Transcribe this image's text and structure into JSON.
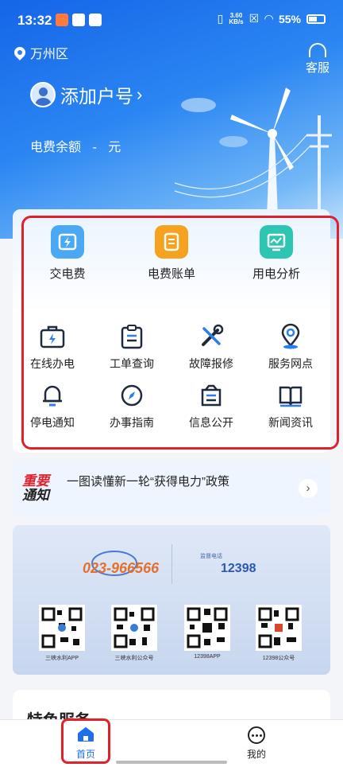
{
  "status_bar": {
    "time": "13:32",
    "net_speed_value": "3.60",
    "net_speed_unit": "KB/s",
    "battery": "55%"
  },
  "header": {
    "location": "万州区",
    "service_label": "客服"
  },
  "account": {
    "add_label": "添加户号",
    "chevron": "›",
    "balance_label": "电费余额",
    "balance_value": "-",
    "balance_unit": "元"
  },
  "quick_services": [
    {
      "label": "交电费",
      "icon": "wallet-bolt-icon",
      "color": "#4aa8f5"
    },
    {
      "label": "电费账单",
      "icon": "bill-icon",
      "color": "#f6a21e"
    },
    {
      "label": "用电分析",
      "icon": "monitor-chart-icon",
      "color": "#2cc6b2"
    }
  ],
  "services": [
    {
      "label": "在线办电",
      "icon": "briefcase-bolt-icon"
    },
    {
      "label": "工单查询",
      "icon": "clipboard-list-icon"
    },
    {
      "label": "故障报修",
      "icon": "wrench-screwdriver-icon"
    },
    {
      "label": "服务网点",
      "icon": "location-pin-icon"
    },
    {
      "label": "停电通知",
      "icon": "bell-icon"
    },
    {
      "label": "办事指南",
      "icon": "compass-icon"
    },
    {
      "label": "信息公开",
      "icon": "document-tray-icon"
    },
    {
      "label": "新闻资讯",
      "icon": "open-book-icon"
    }
  ],
  "notice": {
    "tag_line1": "重要",
    "tag_line2": "通知",
    "text": "一图读懂新一轮“获得电力”政策",
    "arrow": "›"
  },
  "banner": {
    "phone": "023-966566",
    "hotline_tag": "监督电话",
    "hotline": "12398",
    "qr_codes": [
      "三峡水利APP",
      "三峡水利公众号",
      "12398APP",
      "12398公众号"
    ]
  },
  "special": {
    "title": "特色服务"
  },
  "tabbar": {
    "home_label": "首页",
    "me_label": "我的"
  },
  "colors": {
    "primary": "#1f6fe8",
    "highlight": "#e0202a"
  }
}
